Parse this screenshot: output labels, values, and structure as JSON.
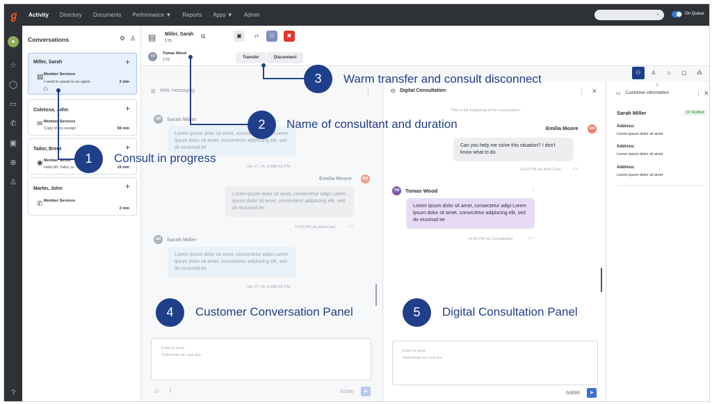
{
  "nav": {
    "items": [
      "Activity",
      "Directory",
      "Documents",
      "Performance ▼",
      "Reports",
      "Apps ▼",
      "Admin"
    ],
    "queue_label": "On Queue"
  },
  "conversations": {
    "title": "Conversations",
    "cards": [
      {
        "name": "Miller, Sarah",
        "queue": "Member Services",
        "preview": "I need to speak to an agent",
        "duration": "2 min"
      },
      {
        "name": "Coletosa, John",
        "queue": "Member Services",
        "preview": "Copy of my receipt",
        "duration": "59 min"
      },
      {
        "name": "Tailor, Brent",
        "queue": "Member Servic",
        "preview": "Hello Mr. Tailor, w",
        "duration": "19 min"
      },
      {
        "name": "Martin, John",
        "queue": "Member Services",
        "preview": "",
        "duration": "2 min"
      }
    ]
  },
  "header": {
    "customer_name": "Miller, Sarah",
    "customer_time": "1:23",
    "consultant_initials": "TW",
    "consultant_name": "Tomas Wood",
    "consultant_time": "1:23",
    "transfer_label": "Transfer",
    "disconnect_label": "Disconnect"
  },
  "web_messaging": {
    "title": "Web messaging",
    "messages": [
      {
        "initials": "SM",
        "sender": "Sarah Miller",
        "text": "Lorem ipsum dolor sit amet, consectetur adipi Lorem ipsum dolor sit amet, consectetur adipiscing elit, sed do eiusmod ter",
        "meta": "Jan 17, 24, H:MM:SS PM"
      },
      {
        "initials": "EM",
        "sender": "Emilia Moore",
        "text": "Lorem ipsum dolor sit amet, consectetur adipi Lorem ipsum dolor sit amet, consectetur adipiscing elit, sed do eiusmod ter",
        "meta": "14:03 PM via Web Chat"
      },
      {
        "initials": "SM",
        "sender": "Sarah Miller",
        "text": "Lorem ipsum dolor sit amet, consectetur adipi Lorem ipsum dolor sit amet, consectetur adipiscing elit, sed do eiusmod ter",
        "meta": "Jan 17, 24, H:MM:SS PM"
      }
    ],
    "placeholder_1": "Enter to send",
    "placeholder_2": "Shift+Enter for new line",
    "counter": "0/2000"
  },
  "digital_consultation": {
    "title": "Digital Consultation",
    "intro": "This is the beginning of the conversation.",
    "messages": [
      {
        "initials": "EM",
        "sender": "Emilia Moore",
        "text": "Can you help me solve this situation? I don't know what to do.",
        "meta": "14:03 PM via Web Chat"
      },
      {
        "initials": "TW",
        "sender": "Tomas Wood",
        "text": "Lorem ipsum dolor sit amet, consectetur adipi Lorem ipsum dolor sit amet, consectetur adipiscing elit, sed do eiusmod ter",
        "meta": "14:03 PM via Consultation"
      }
    ],
    "placeholder_1": "Enter to send",
    "placeholder_2": "Shift+Enter for new line",
    "counter": "0/2000"
  },
  "customer_info": {
    "title": "Customer information",
    "name": "Sarah Miller",
    "badge": "ID Verified",
    "addresses": [
      {
        "label": "Address:",
        "value": "Lorem ipsum dolor sit amet"
      },
      {
        "label": "Address:",
        "value": "Lorem ipsum dolor sit amet"
      },
      {
        "label": "Address:",
        "value": "Lorem ipsum dolor sit amet"
      }
    ]
  },
  "annotations": [
    {
      "number": "1",
      "text": "Consult in progress"
    },
    {
      "number": "2",
      "text": "Name of consultant and duration"
    },
    {
      "number": "3",
      "text": "Warm transfer and consult disconnect"
    },
    {
      "number": "4",
      "text": "Customer Conversation Panel"
    },
    {
      "number": "5",
      "text": "Digital Consultation Panel"
    }
  ],
  "colors": {
    "accent": "#1f3f8a",
    "brand": "#ff4f1f",
    "disconnect_red": "#e2362b",
    "consult_bubble": "#e8dcf5"
  }
}
